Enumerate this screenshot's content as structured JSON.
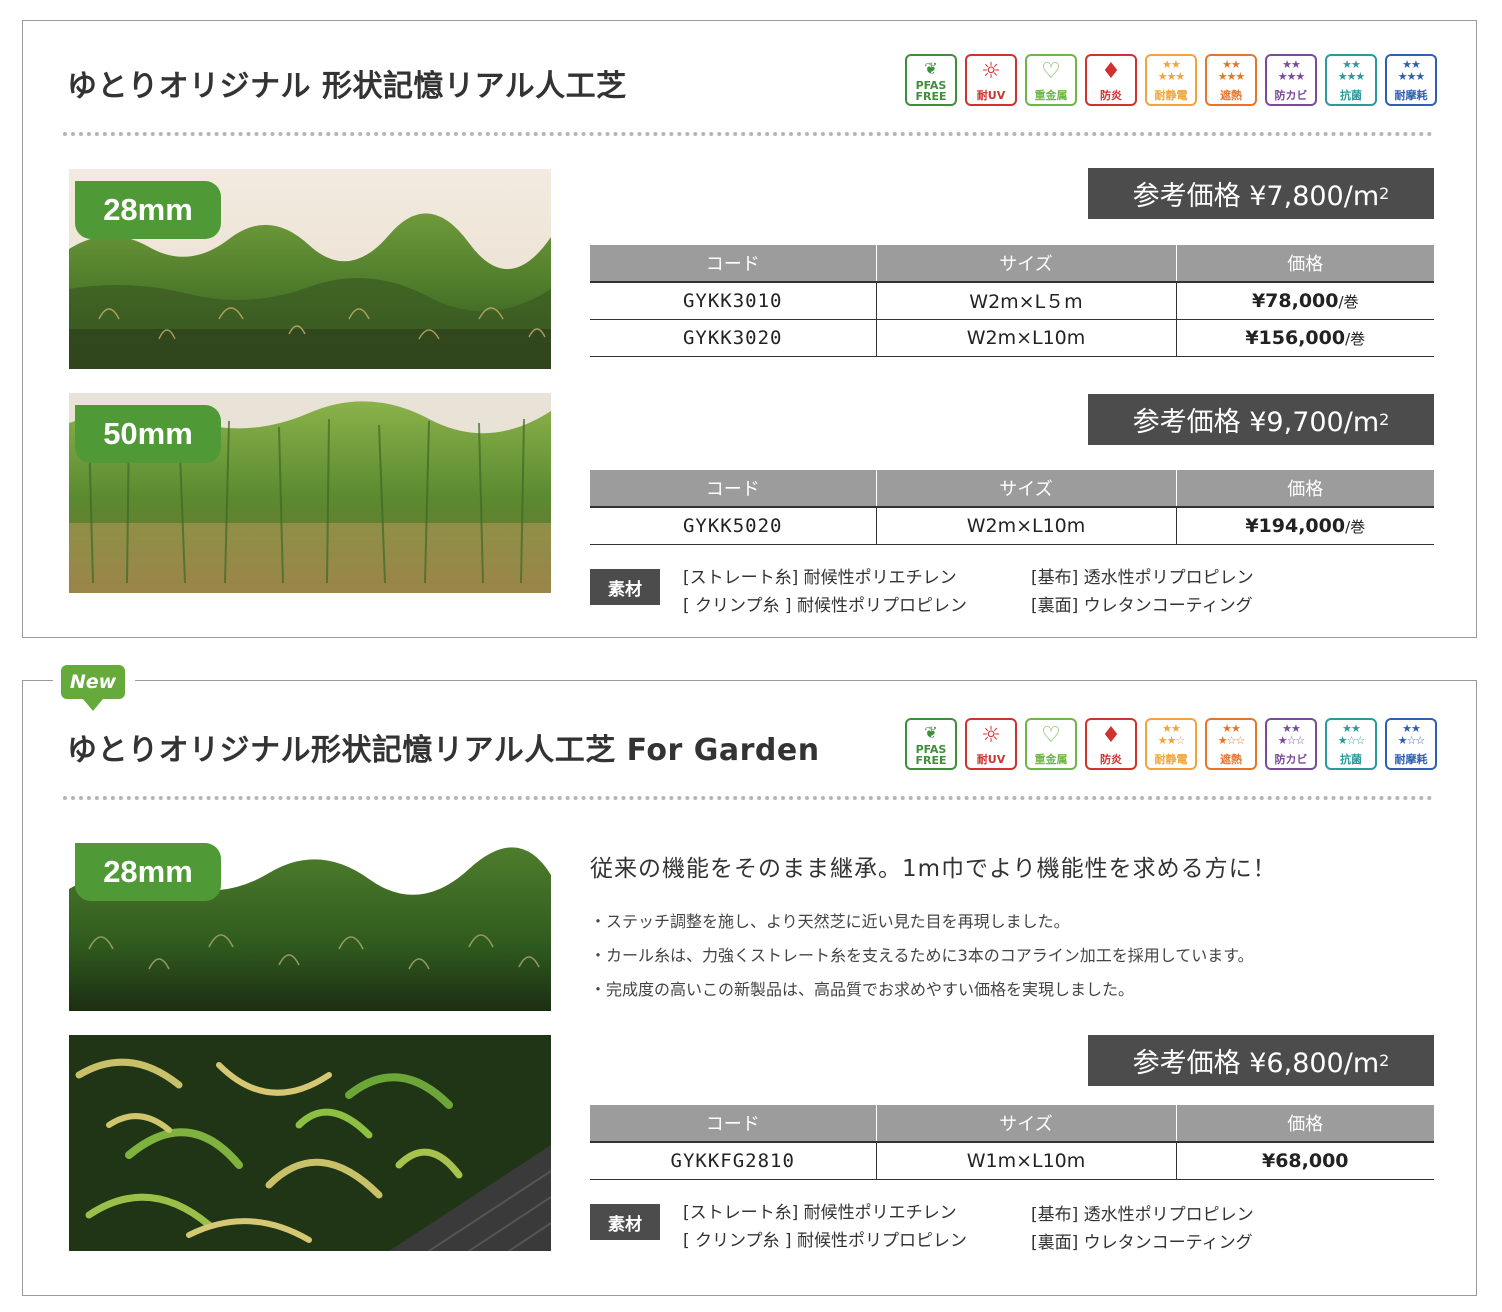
{
  "panels": [
    {
      "title": "ゆとりオリジナル 形状記憶リアル人工芝",
      "photos": [
        {
          "size": "28mm"
        },
        {
          "size": "50mm"
        }
      ],
      "blocks": [
        {
          "price_label": "参考価格 ¥7,800/m",
          "price_sup": "2",
          "headers": [
            "コード",
            "サイズ",
            "価格"
          ],
          "rows": [
            {
              "code": "GYKK3010",
              "size": "W2m×L５m",
              "price": "¥78,000",
              "unit": "/巻"
            },
            {
              "code": "GYKK3020",
              "size": "W2m×L10m",
              "price": "¥156,000",
              "unit": "/巻"
            }
          ]
        },
        {
          "price_label": "参考価格 ¥9,700/m",
          "price_sup": "2",
          "headers": [
            "コード",
            "サイズ",
            "価格"
          ],
          "rows": [
            {
              "code": "GYKK5020",
              "size": "W2m×L10m",
              "price": "¥194,000",
              "unit": "/巻"
            }
          ]
        }
      ],
      "material": {
        "label": "素材",
        "lines_left": [
          "[ストレート糸] 耐候性ポリエチレン",
          "[ クリンプ糸 ] 耐候性ポリプロピレン"
        ],
        "lines_right": [
          "[基布] 透水性ポリプロピレン",
          "[裏面] ウレタンコーティング"
        ]
      }
    },
    {
      "badge": "New",
      "title": "ゆとりオリジナル形状記憶リアル人工芝 For Garden",
      "photos": [
        {
          "size": "28mm"
        }
      ],
      "lead": "従来の機能をそのまま継承。1m巾でより機能性を求める方に！",
      "bullets": [
        "・ステッチ調整を施し、より天然芝に近い見た目を再現しました。",
        "・カール糸は、力強くストレート糸を支えるために3本のコアライン加工を採用しています。",
        "・完成度の高いこの新製品は、高品質でお求めやすい価格を実現しました。"
      ],
      "blocks": [
        {
          "price_label": "参考価格 ¥6,800/m",
          "price_sup": "2",
          "headers": [
            "コード",
            "サイズ",
            "価格"
          ],
          "rows": [
            {
              "code": "GYKKFG2810",
              "size": "W1m×L10m",
              "price": "¥68,000",
              "unit": ""
            }
          ]
        }
      ],
      "material": {
        "label": "素材",
        "lines_left": [
          "[ストレート糸] 耐候性ポリエチレン",
          "[ クリンプ糸 ] 耐候性ポリプロピレン"
        ],
        "lines_right": [
          "[基布] 透水性ポリプロピレン",
          "[裏面] ウレタンコーティング"
        ]
      }
    }
  ],
  "feature_icons": {
    "panel1": [
      {
        "name": "pfas-free-icon",
        "label": "PFAS FREE",
        "color": "#3f8f3a"
      },
      {
        "name": "uv-icon",
        "label": "耐UV",
        "color": "#d0322f",
        "glyph": "☼"
      },
      {
        "name": "heavy-metal-icon",
        "label": "重金属",
        "color": "#6fb54a",
        "glyph": "♡"
      },
      {
        "name": "flame-icon",
        "label": "防炎",
        "color": "#d0322f",
        "glyph": "♦"
      },
      {
        "name": "antistatic-icon",
        "label": "耐静電",
        "color": "#f2a43a",
        "stars": "★★\n★★★"
      },
      {
        "name": "heat-shield-icon",
        "label": "遮熱",
        "color": "#e8742a",
        "stars": "★★\n★★★"
      },
      {
        "name": "antimold-icon",
        "label": "防カビ",
        "color": "#7b4a9a",
        "stars": "★★\n★★★"
      },
      {
        "name": "antibacterial-icon",
        "label": "抗菌",
        "color": "#2a9a9a",
        "stars": "★★\n★★★"
      },
      {
        "name": "abrasion-icon",
        "label": "耐摩耗",
        "color": "#2f5fb0",
        "stars": "★★\n★★★"
      }
    ],
    "panel2": [
      {
        "name": "pfas-free-icon",
        "label": "PFAS FREE",
        "color": "#3f8f3a"
      },
      {
        "name": "uv-icon",
        "label": "耐UV",
        "color": "#d0322f",
        "glyph": "☼"
      },
      {
        "name": "heavy-metal-icon",
        "label": "重金属",
        "color": "#6fb54a",
        "glyph": "♡"
      },
      {
        "name": "flame-icon",
        "label": "防炎",
        "color": "#d0322f",
        "glyph": "♦"
      },
      {
        "name": "antistatic-icon",
        "label": "耐静電",
        "color": "#f2a43a",
        "stars": "★★\n★★☆"
      },
      {
        "name": "heat-shield-icon",
        "label": "遮熱",
        "color": "#e8742a",
        "stars": "★★\n★☆☆"
      },
      {
        "name": "antimold-icon",
        "label": "防カビ",
        "color": "#7b4a9a",
        "stars": "★★\n★☆☆"
      },
      {
        "name": "antibacterial-icon",
        "label": "抗菌",
        "color": "#2a9a9a",
        "stars": "★★\n★☆☆"
      },
      {
        "name": "abrasion-icon",
        "label": "耐摩耗",
        "color": "#2f5fb0",
        "stars": "★★\n★☆☆"
      }
    ]
  }
}
